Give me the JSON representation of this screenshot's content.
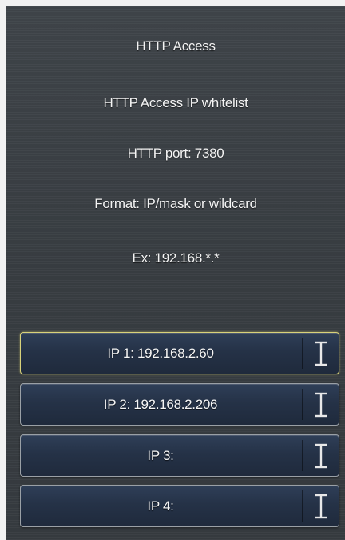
{
  "info": {
    "title": "HTTP Access",
    "subtitle": "HTTP Access IP whitelist",
    "port": "HTTP port: 7380",
    "format": "Format: IP/mask or wildcard",
    "example": "Ex: 192.168.*.*"
  },
  "entries": [
    {
      "label": "IP 1: 192.168.2.60",
      "selected": true,
      "icon": "text-cursor-icon"
    },
    {
      "label": "IP 2: 192.168.2.206",
      "selected": false,
      "icon": "text-cursor-icon"
    },
    {
      "label": "IP 3:",
      "selected": false,
      "icon": "text-cursor-icon"
    },
    {
      "label": "IP 4:",
      "selected": false,
      "icon": "text-cursor-icon"
    }
  ],
  "colors": {
    "panel_background": "#3b4045",
    "button_background": "#253247",
    "button_border": "#9aa0a6",
    "selected_border": "#d8d27a",
    "text": "#f4f4f4"
  }
}
